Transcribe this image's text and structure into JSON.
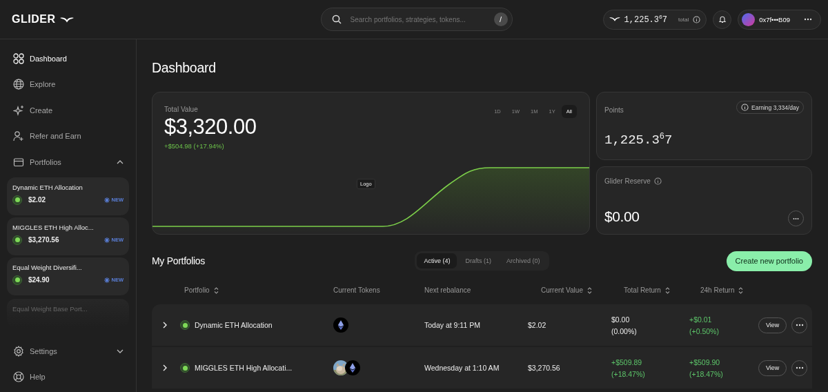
{
  "brand": {
    "name": "GLIDER"
  },
  "search": {
    "placeholder": "Search portfolios, strategies, tokens...",
    "shortcut": "/"
  },
  "points_pill": {
    "value": "1,225.3$^{6}$7",
    "label": "total"
  },
  "account": {
    "address": "0x7f•••B09"
  },
  "sidebar": {
    "items": [
      {
        "label": "Dashboard",
        "selected": true
      },
      {
        "label": "Explore",
        "selected": false
      },
      {
        "label": "Create",
        "selected": false
      },
      {
        "label": "Refer and Earn",
        "selected": false
      },
      {
        "label": "Portfolios",
        "selected": false,
        "expanded": true
      }
    ],
    "portfolios": [
      {
        "name": "Dynamic ETH Allocation",
        "value": "$2.02",
        "active": true,
        "badge": "NEW",
        "faded": false
      },
      {
        "name": "MIGGLES ETH High Alloc...",
        "value": "$3,270.56",
        "active": true,
        "badge": "NEW",
        "faded": false
      },
      {
        "name": "Equal Weight Diversifi...",
        "value": "$24.90",
        "active": true,
        "badge": "NEW",
        "faded": false
      },
      {
        "name": "Equal Weight Base Port...",
        "faded": true
      }
    ],
    "bottom_items": [
      {
        "label": "Settings",
        "expanded": false
      },
      {
        "label": "Help"
      }
    ]
  },
  "page_title": "Dashboard",
  "total_value": {
    "label": "Total Value",
    "value": "$3,320.00",
    "change": "+$504.98 (+17.94%)",
    "tooltip": "Logo",
    "timeframes": [
      {
        "label": "1D",
        "selected": false
      },
      {
        "label": "1W",
        "selected": false
      },
      {
        "label": "1M",
        "selected": false
      },
      {
        "label": "1Y",
        "selected": false
      },
      {
        "label": "All",
        "selected": true
      }
    ]
  },
  "points_card": {
    "label": "Points",
    "earning": "Earning 3,334/day",
    "value": "1,225.3$^{6}$7"
  },
  "reserve_card": {
    "label": "Glider Reserve",
    "value": "$0.00"
  },
  "portfolios": {
    "title": "My Portfolios",
    "tabs": [
      {
        "label": "Active (4)",
        "selected": true
      },
      {
        "label": "Drafts (1)",
        "selected": false
      },
      {
        "label": "Archived (0)",
        "selected": false
      }
    ],
    "create_button": "Create new portfolio",
    "columns": [
      {
        "label": "Portfolio",
        "sortable": true
      },
      {
        "label": "Current Tokens",
        "sortable": false
      },
      {
        "label": "Next rebalance",
        "sortable": false
      },
      {
        "label": "Current Value",
        "sortable": true
      },
      {
        "label": "Total Return",
        "sortable": true
      },
      {
        "label": "24h Return",
        "sortable": true
      }
    ],
    "rows": [
      {
        "name": "Dynamic ETH Allocation",
        "active": true,
        "tokens": [
          {
            "kind": "eth"
          }
        ],
        "next_rebalance": "Today at 9:11 PM",
        "current_value": "$2.02",
        "total_return": {
          "value": "$0.00",
          "percent": "(0.00%)",
          "positive": false
        },
        "return_24h": {
          "value": "+$0.01",
          "percent": "(+0.50%)",
          "positive": true
        },
        "view": "View"
      },
      {
        "name": "MIGGLES ETH High Allocati...",
        "active": true,
        "tokens": [
          {
            "kind": "picture"
          },
          {
            "kind": "eth"
          }
        ],
        "next_rebalance": "Wednesday at 1:10 AM",
        "current_value": "$3,270.56",
        "total_return": {
          "value": "+$509.89",
          "percent": "(+18.47%)",
          "positive": true
        },
        "return_24h": {
          "value": "+$509.90",
          "percent": "(+18.47%)",
          "positive": true
        },
        "view": "View"
      }
    ]
  }
}
